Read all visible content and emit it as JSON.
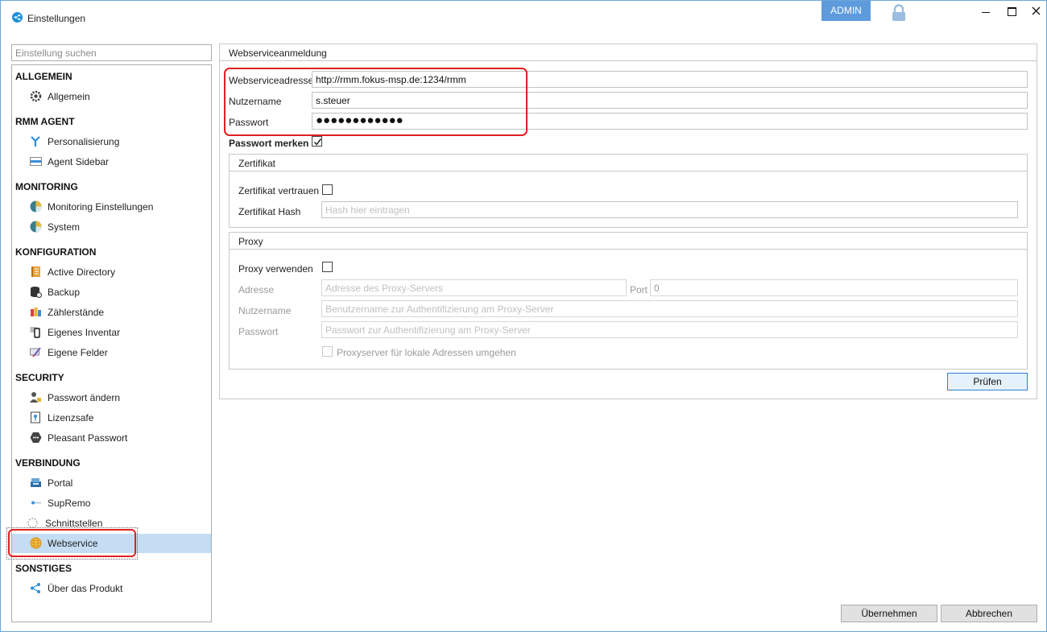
{
  "window": {
    "title": "Einstellungen",
    "admin_badge": "ADMIN"
  },
  "sidebar": {
    "search_placeholder": "Einstellung suchen",
    "sections": [
      {
        "label": "ALLGEMEIN",
        "items": [
          {
            "label": "Allgemein",
            "icon": "gear-icon"
          }
        ]
      },
      {
        "label": "RMM AGENT",
        "items": [
          {
            "label": "Personalisierung",
            "icon": "brush-icon"
          },
          {
            "label": "Agent Sidebar",
            "icon": "sidebar-icon"
          }
        ]
      },
      {
        "label": "MONITORING",
        "items": [
          {
            "label": "Monitoring Einstellungen",
            "icon": "monitoring-icon"
          },
          {
            "label": "System",
            "icon": "system-icon"
          }
        ]
      },
      {
        "label": "KONFIGURATION",
        "items": [
          {
            "label": "Active Directory",
            "icon": "directory-icon"
          },
          {
            "label": "Backup",
            "icon": "database-icon"
          },
          {
            "label": "Zählerstände",
            "icon": "counter-icon"
          },
          {
            "label": "Eigenes Inventar",
            "icon": "device-icon"
          },
          {
            "label": "Eigene Felder",
            "icon": "edit-icon"
          }
        ]
      },
      {
        "label": "SECURITY",
        "items": [
          {
            "label": "Passwort ändern",
            "icon": "user-key-icon"
          },
          {
            "label": "Lizenzsafe",
            "icon": "license-icon"
          },
          {
            "label": "Pleasant Passwort",
            "icon": "pleasant-icon"
          }
        ]
      },
      {
        "label": "VERBINDUNG",
        "items": [
          {
            "label": "Portal",
            "icon": "portal-icon"
          },
          {
            "label": "SupRemo",
            "icon": "remote-icon"
          },
          {
            "label": "Schnittstellen",
            "icon": "interface-icon"
          },
          {
            "label": "Webservice",
            "icon": "globe-icon",
            "selected": true
          }
        ]
      },
      {
        "label": "SONSTIGES",
        "items": [
          {
            "label": "Über das Produkt",
            "icon": "share-icon"
          }
        ]
      }
    ]
  },
  "webservice": {
    "group_title": "Webserviceanmeldung",
    "address_label": "Webserviceadresse",
    "address_value": "http://rmm.fokus-msp.de:1234/rmm",
    "user_label": "Nutzername",
    "user_value": "s.steuer",
    "password_label": "Passwort",
    "password_dots": "●●●●●●●●●●●●",
    "remember_label": "Passwort merken",
    "remember_checked": true
  },
  "certificate": {
    "group_title": "Zertifikat",
    "trust_label": "Zertifikat vertrauen",
    "hash_label": "Zertifikat Hash",
    "hash_placeholder": "Hash hier eintragen"
  },
  "proxy": {
    "group_title": "Proxy",
    "use_label": "Proxy verwenden",
    "address_label": "Adresse",
    "address_placeholder": "Adresse des Proxy-Servers",
    "port_label": "Port",
    "port_value": "0",
    "user_label": "Nutzername",
    "user_placeholder": "Benutzername zur Authentifizierung am Proxy-Server",
    "password_label": "Passwort",
    "password_placeholder": "Passwort zur Authentifizierung am Proxy-Server",
    "bypass_label": "Proxyserver für lokale Adressen umgehen"
  },
  "buttons": {
    "check": "Prüfen",
    "apply": "Übernehmen",
    "cancel": "Abbrechen"
  }
}
